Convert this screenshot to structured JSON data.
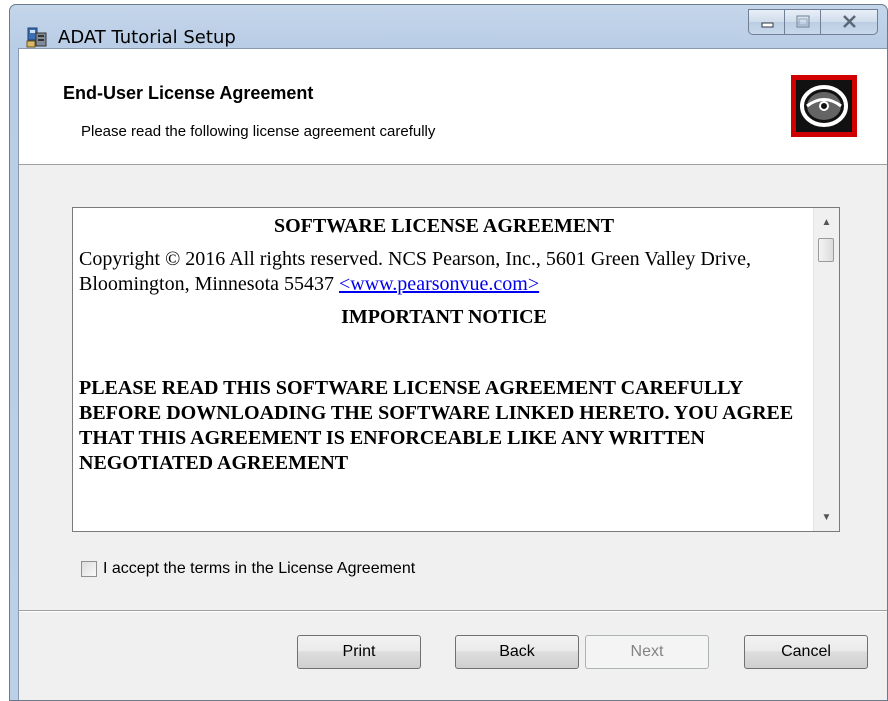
{
  "window": {
    "title": "ADAT Tutorial Setup"
  },
  "banner": {
    "title": "End-User License Agreement",
    "subtitle": "Please read the following license agreement carefully"
  },
  "license": {
    "heading": "SOFTWARE LICENSE AGREEMENT",
    "copyright": "Copyright © 2016 All rights reserved. NCS Pearson, Inc., 5601 Green Valley Drive, Bloomington, Minnesota 55437 ",
    "link": "<www.pearsonvue.com>",
    "notice_title": "IMPORTANT NOTICE",
    "notice_body": "PLEASE READ THIS SOFTWARE LICENSE AGREEMENT CAREFULLY BEFORE DOWNLOADING THE SOFTWARE LINKED HERETO.  YOU AGREE THAT THIS AGREEMENT IS ENFORCEABLE LIKE ANY WRITTEN NEGOTIATED AGREEMENT"
  },
  "accept": {
    "label": "I accept the terms in the License Agreement",
    "checked": false
  },
  "buttons": {
    "print": "Print",
    "back": "Back",
    "next": "Next",
    "cancel": "Cancel"
  },
  "colors": {
    "logo_background": "#d00000",
    "link": "#0000ee"
  },
  "icons": {
    "app": "installer-icon",
    "logo": "disc-icon"
  }
}
